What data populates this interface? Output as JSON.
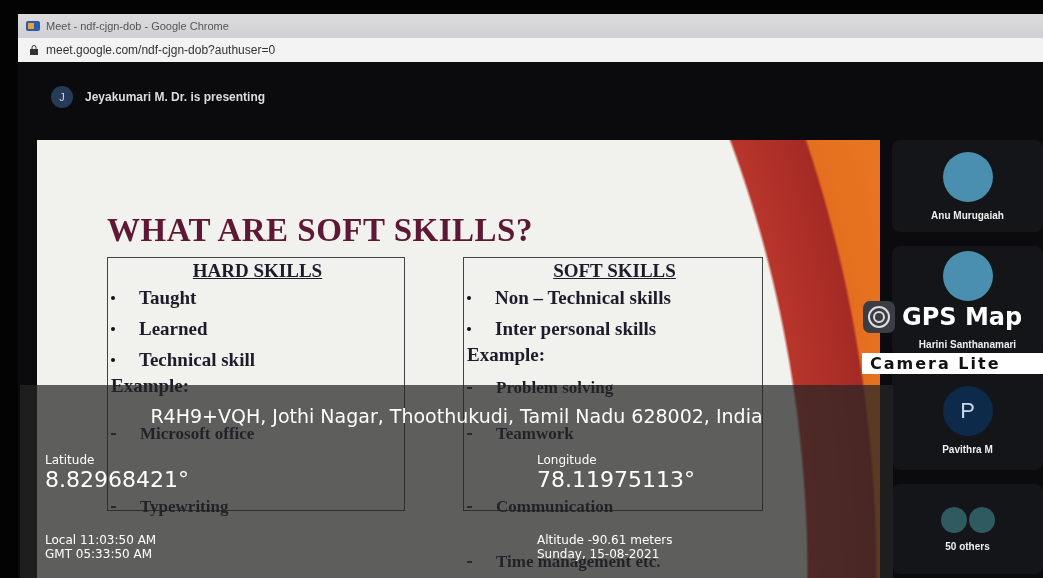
{
  "browser": {
    "title": "Meet - ndf-cjgn-dob - Google Chrome",
    "url": "meet.google.com/ndf-cjgn-dob?authuser=0"
  },
  "presenter": {
    "initial": "J",
    "label": "Jeyakumari M. Dr. is presenting"
  },
  "slide": {
    "title": "WHAT ARE SOFT SKILLS?",
    "columns": [
      {
        "heading": "HARD SKILLS",
        "items": [
          "Taught",
          "Learned",
          "Technical skill"
        ],
        "example_label": "Example:",
        "examples": [
          "Microsoft  office",
          "Typewriting"
        ]
      },
      {
        "heading": "SOFT SKILLS",
        "items": [
          "Non – Technical skills",
          "Inter personal skills"
        ],
        "example_label": "Example:",
        "examples": [
          "Problem solving",
          "Teamwork",
          "Communication",
          "Time management etc."
        ]
      }
    ]
  },
  "participants": [
    {
      "kind": "photo",
      "name": "Anu Murugaiah"
    },
    {
      "kind": "photo",
      "name": "Harini Santhanamari"
    },
    {
      "kind": "initial",
      "initial": "P",
      "name": "Pavithra M"
    },
    {
      "kind": "group",
      "name": "50 others"
    }
  ],
  "gps": {
    "brand_top": "GPS Map",
    "brand_bottom": "Camera Lite",
    "address": "R4H9+VQH, Jothi Nagar, Thoothukudi, Tamil Nadu 628002, India",
    "latitude_label": "Latitude",
    "latitude": "8.82968421°",
    "local_time": "Local 11:03:50 AM",
    "gmt_time": "GMT 05:33:50 AM",
    "longitude_label": "Longitude",
    "longitude": "78.11975113°",
    "altitude": "Altitude -90.61 meters",
    "date": "Sunday, 15-08-2021"
  }
}
